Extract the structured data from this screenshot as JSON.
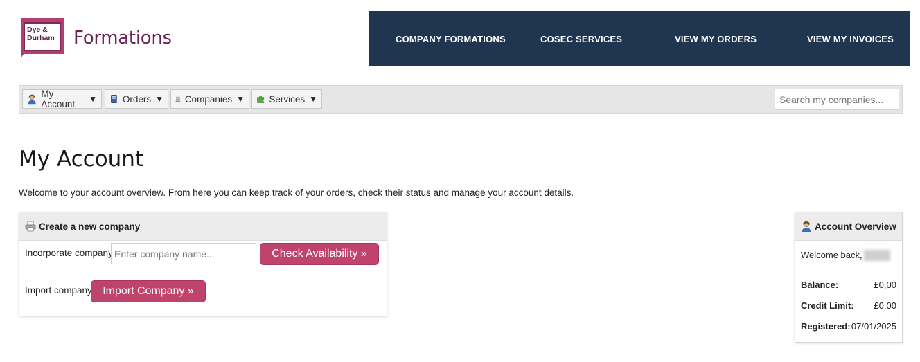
{
  "brand": {
    "mark_text_line1": "Dye &",
    "mark_text_line2": "Durham",
    "name": "Formations",
    "colors": {
      "primary": "#6b2353",
      "accent": "#b63d6d",
      "nav_bg": "#1f3550"
    }
  },
  "topnav": {
    "items": [
      {
        "label": "COMPANY FORMATIONS"
      },
      {
        "label": "COSEC SERVICES"
      },
      {
        "label": "VIEW MY ORDERS"
      },
      {
        "label": "VIEW MY INVOICES"
      }
    ]
  },
  "toolbar": {
    "items": [
      {
        "label": "My Account",
        "icon": "user-icon"
      },
      {
        "label": "Orders",
        "icon": "book-icon"
      },
      {
        "label": "Companies",
        "icon": "building-icon"
      },
      {
        "label": "Services",
        "icon": "puzzle-icon"
      }
    ],
    "dropdown_glyph": "▼",
    "search_placeholder": "Search my companies..."
  },
  "page": {
    "title": "My Account",
    "intro": "Welcome to your account overview. From here you can keep track of your orders, check their status and manage your account details."
  },
  "create_panel": {
    "heading": "Create a new company",
    "incorporate_label": "Incorporate company:",
    "name_placeholder": "Enter company name...",
    "check_button": "Check Availability »",
    "import_label": "Import company:",
    "import_button": "Import Company »",
    "button_color": "#bf436a"
  },
  "overview_panel": {
    "heading": "Account Overview",
    "welcome": "Welcome back,",
    "balance_label": "Balance:",
    "balance_value": "£0,00",
    "credit_label": "Credit Limit:",
    "credit_value": "£0,00",
    "registered_label": "Registered:",
    "registered_value": "07/01/2025"
  }
}
